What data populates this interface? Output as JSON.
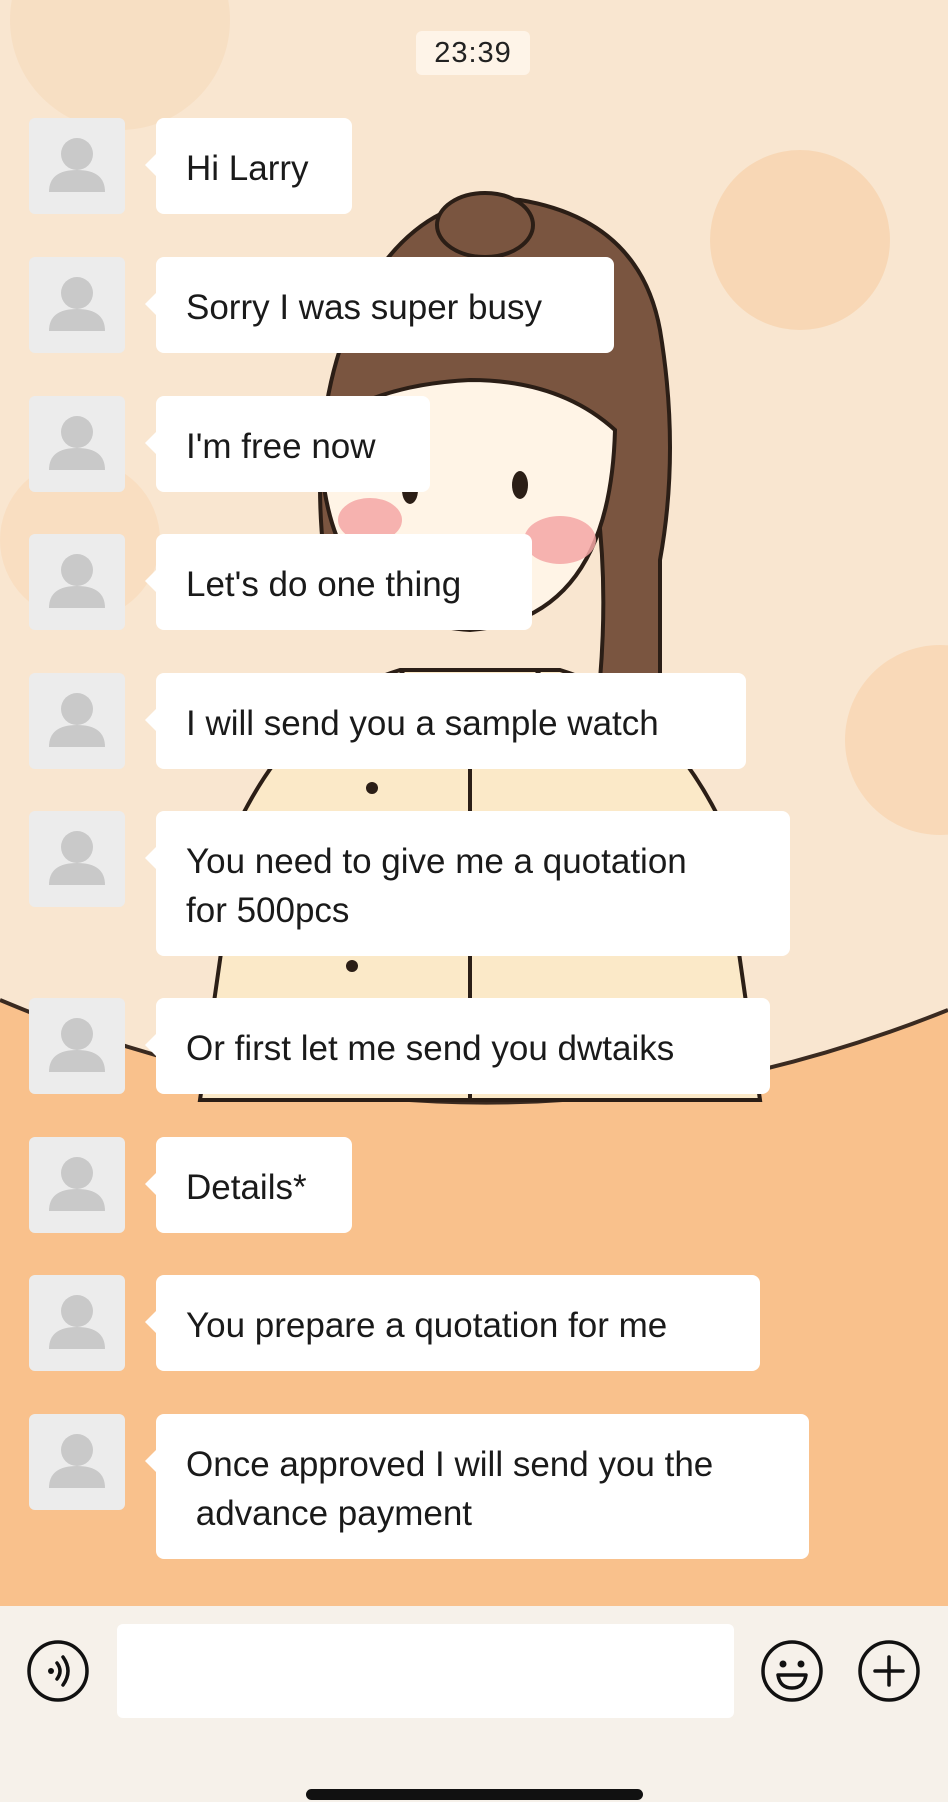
{
  "status": {
    "time": "23:39"
  },
  "messages": [
    {
      "text": "Hi Larry"
    },
    {
      "text": "Sorry I was super busy"
    },
    {
      "text": "I'm free now"
    },
    {
      "text": "Let's do one thing"
    },
    {
      "text": "I will send you a sample watch"
    },
    {
      "text": "You need to give me a quotation\nfor 500pcs"
    },
    {
      "text": "Or first let me send you dwtaiks"
    },
    {
      "text": "Details*"
    },
    {
      "text": "You prepare a quotation for me"
    },
    {
      "text": "Once approved I will send you the\n advance payment"
    }
  ],
  "input_bar": {
    "icons": [
      "voice-icon",
      "emoji-icon",
      "plus-icon"
    ],
    "message_value": ""
  },
  "colors": {
    "background_top": "#f9e6d0",
    "background_bottom": "#f9c18c",
    "bubble": "#ffffff",
    "input_bar": "#f6f1ea"
  }
}
